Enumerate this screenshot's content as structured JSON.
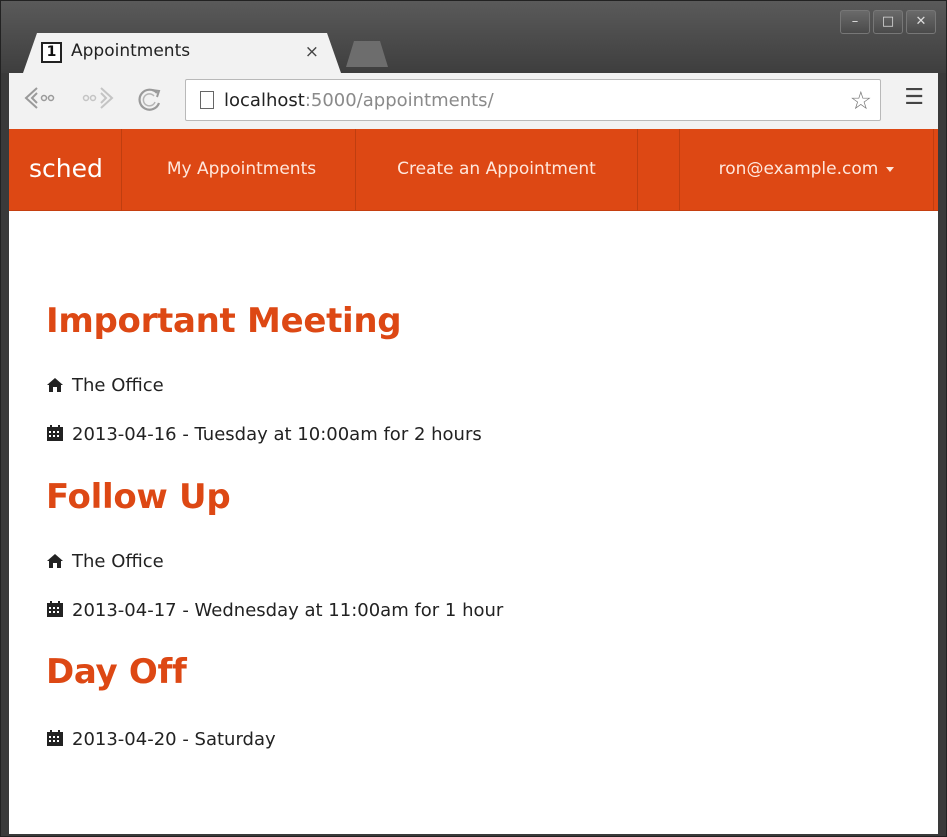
{
  "browser": {
    "tab_title": "Appointments",
    "tab_favicon_text": "1",
    "tab_close_symbol": "×",
    "url_host": "localhost",
    "url_rest": ":5000/appointments/",
    "icons": [
      "back-icon",
      "forward-icon",
      "reload-icon",
      "page-icon",
      "star-icon",
      "menu-icon"
    ],
    "window_controls": [
      "minimize-icon",
      "maximize-icon",
      "close-icon"
    ]
  },
  "navbar": {
    "brand": "sched",
    "links": [
      "My Appointments",
      "Create an Appointment"
    ],
    "user": "ron@example.com",
    "color": "#dd4814"
  },
  "appointments": [
    {
      "title": "Important Meeting",
      "location": "The Office",
      "when": "2013-04-16 - Tuesday at 10:00am for 2 hours"
    },
    {
      "title": "Follow Up",
      "location": "The Office",
      "when": "2013-04-17 - Wednesday at 11:00am for 1 hour"
    },
    {
      "title": "Day Off",
      "when": "2013-04-20 - Saturday"
    }
  ],
  "colors": {
    "accent": "#dd4814",
    "text": "#222222"
  }
}
